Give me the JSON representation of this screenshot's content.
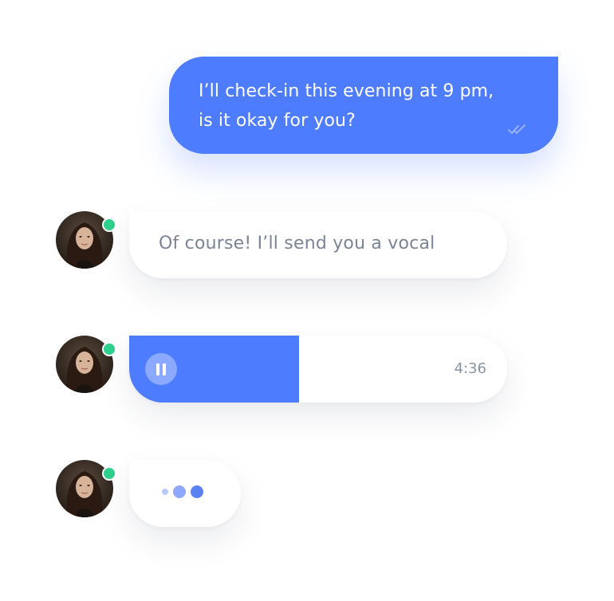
{
  "colors": {
    "accent": "#4e7cff",
    "online": "#2fd08e",
    "incoming_text": "#7b8496",
    "timestamp": "#8a93a3",
    "typing_dot_light": "#b9c9ff",
    "typing_dot_mid": "#8ea9ff",
    "typing_dot_dark": "#5a82f5"
  },
  "outgoing_message": {
    "line1": "I’ll check-in this evening at 9 pm,",
    "line2": "is it okay for you?",
    "receipt_icon": "double-check-icon"
  },
  "incoming_text_message": {
    "text": "Of course! I’ll send you a vocal",
    "avatar_icon": "avatar-photo",
    "online": true
  },
  "voice_message": {
    "duration": "4:36",
    "progress": 0.45,
    "control_icon": "pause-icon",
    "online": true
  },
  "typing_indicator": {
    "icon": "typing-dots-icon",
    "online": true
  }
}
